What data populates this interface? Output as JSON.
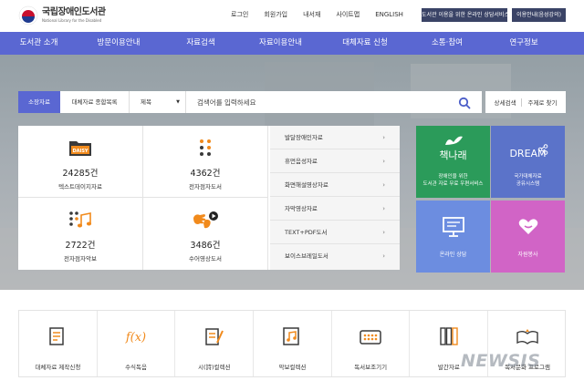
{
  "header": {
    "logo_title": "국립장애인도서관",
    "logo_subtitle": "National Library for the Disabled",
    "util_links": [
      "로그인",
      "회원가입",
      "내서재",
      "사이트맵",
      "ENGLISH"
    ],
    "counsel_button": "도서관 이용을 위한 온라인 상담서비스",
    "guide_button": "이용안내(음성강의)"
  },
  "nav": {
    "items": [
      "도서관 소개",
      "방문이용안내",
      "자료검색",
      "자료이용안내",
      "대체자료 신청",
      "소통·참여",
      "연구정보"
    ]
  },
  "search": {
    "tabs": [
      "소장자료",
      "대체자료 종합목록"
    ],
    "field_select": "제목",
    "placeholder": "검색어를 입력하세요",
    "advanced": "상세검색",
    "subject": "주제로 찾기"
  },
  "stats": [
    {
      "count": "24285건",
      "label": "텍스트데이지자료",
      "icon": "daisy-folder-icon"
    },
    {
      "count": "4362건",
      "label": "전자점자도서",
      "icon": "braille-dots-icon"
    },
    {
      "count": "2722건",
      "label": "전자점자악보",
      "icon": "braille-music-icon"
    },
    {
      "count": "3486건",
      "label": "수어영상도서",
      "icon": "sign-video-icon"
    }
  ],
  "side_links": [
    "발달장애인자료",
    "휴먼음성자료",
    "화면해설영상자료",
    "자막영상자료",
    "TEXT+PDF도서",
    "보이스브레일도서"
  ],
  "tiles": {
    "tile1": {
      "title": "책나래",
      "desc1": "장애인을 위한",
      "desc2": "도서관 자료 무료 우편서비스",
      "color": "#2b9b5a"
    },
    "tile2": {
      "title": "DREAM",
      "desc1": "국가대체자료",
      "desc2": "공유시스템",
      "color": "#5b73c9"
    },
    "tile3": {
      "label": "온라인 상담",
      "color": "#6c8de0"
    },
    "tile4": {
      "label": "자원봉사",
      "color": "#d164c6"
    }
  },
  "services": [
    {
      "label": "대체자료 제작신청",
      "icon": "request-document-icon"
    },
    {
      "label": "수식독음",
      "icon": "formula-icon"
    },
    {
      "label": "시(詩)컬렉션",
      "icon": "poem-icon"
    },
    {
      "label": "악보컬렉션",
      "icon": "music-score-icon"
    },
    {
      "label": "독서보조기기",
      "icon": "reading-device-icon"
    },
    {
      "label": "발간자료",
      "icon": "publication-icon"
    },
    {
      "label": "독서문화 프로그램",
      "icon": "reading-program-icon"
    }
  ],
  "watermark": "NEWSIS",
  "colors": {
    "nav": "#5a67d2",
    "accent": "#f18a1c",
    "dark_button": "#3a4366"
  }
}
